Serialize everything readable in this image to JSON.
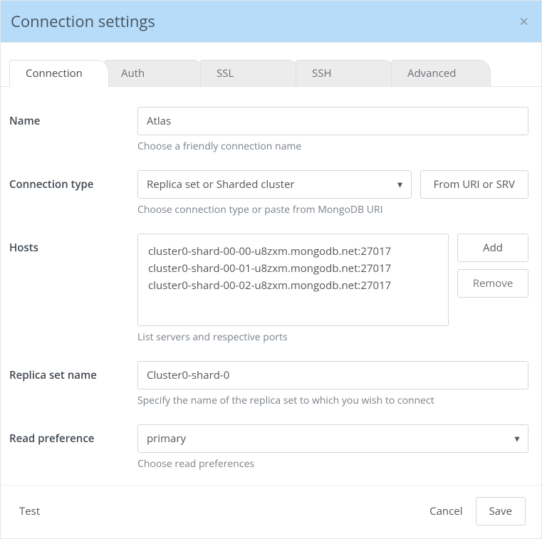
{
  "dialog": {
    "title": "Connection settings"
  },
  "tabs": {
    "connection": "Connection",
    "auth": "Auth",
    "ssl": "SSL",
    "ssh": "SSH",
    "advanced": "Advanced"
  },
  "fields": {
    "name": {
      "label": "Name",
      "value": "Atlas",
      "helper": "Choose a friendly connection name"
    },
    "connection_type": {
      "label": "Connection type",
      "value": "Replica set or Sharded cluster",
      "helper": "Choose connection type or paste from MongoDB URI",
      "from_uri_btn": "From URI or SRV"
    },
    "hosts": {
      "label": "Hosts",
      "items": [
        "cluster0-shard-00-00-u8zxm.mongodb.net:27017",
        "cluster0-shard-00-01-u8zxm.mongodb.net:27017",
        "cluster0-shard-00-02-u8zxm.mongodb.net:27017"
      ],
      "helper": "List servers and respective ports",
      "add_btn": "Add",
      "remove_btn": "Remove"
    },
    "replica_set": {
      "label": "Replica set name",
      "value": "Cluster0-shard-0",
      "helper": "Specify the name of the replica set to which you wish to connect"
    },
    "read_pref": {
      "label": "Read preference",
      "value": "primary",
      "helper": "Choose read preferences"
    }
  },
  "footer": {
    "test": "Test",
    "cancel": "Cancel",
    "save": "Save"
  }
}
